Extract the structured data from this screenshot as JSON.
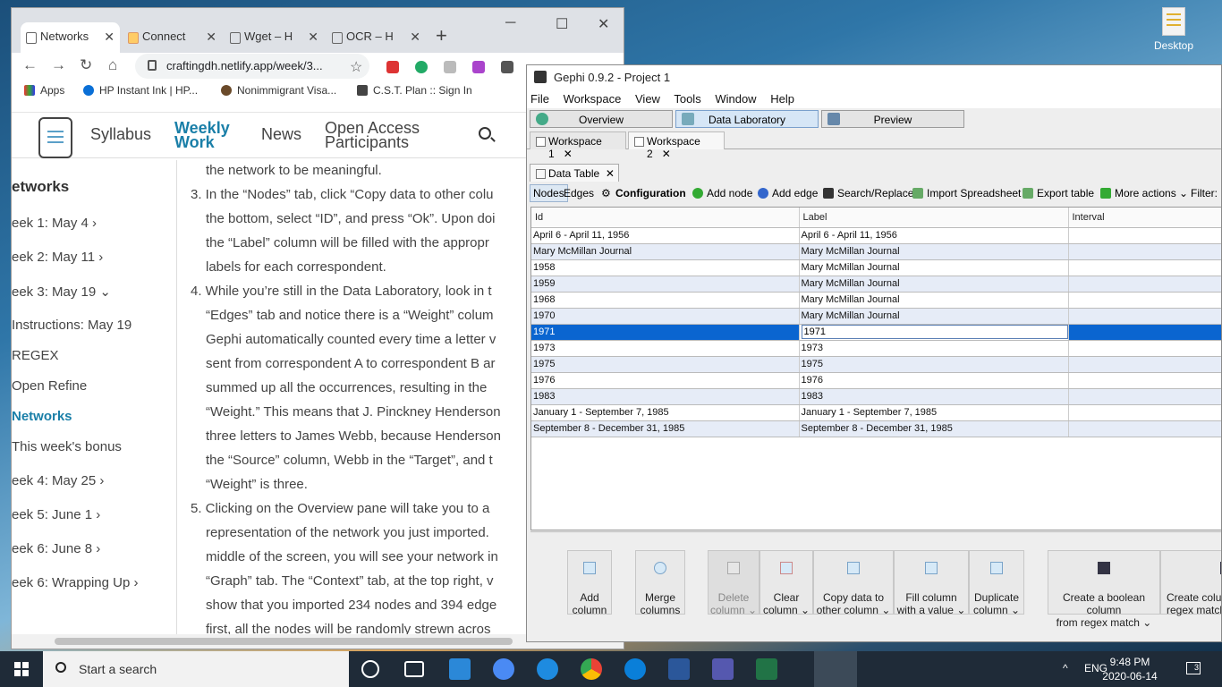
{
  "desktop": {
    "icon_label": "Desktop"
  },
  "chrome": {
    "tabs": [
      "Networks",
      "Connect",
      "Wget – H",
      "OCR – H"
    ],
    "address": "craftingdh.netlify.app/week/3...",
    "bookmarks": [
      "Apps",
      "HP Instant Ink | HP...",
      "Nonimmigrant Visa...",
      "C.S.T. Plan :: Sign In"
    ],
    "site_nav": {
      "syllabus": "Syllabus",
      "weekly_1": "Weekly",
      "weekly_2": "Work",
      "news": "News",
      "open_1": "Open Access",
      "open_2": "Participants"
    },
    "sidebar": {
      "heading": "etworks",
      "items": [
        "eek 1: May 4 ›",
        "eek 2: May 11 ›",
        "eek 3: May 19 ⌄",
        "Instructions: May 19",
        "REGEX",
        "Open Refine",
        "Networks",
        "This week's bonus",
        "eek 4: May 25 ›",
        "eek 5: June 1 ›",
        "eek 6: June 8 ›",
        "eek 6: Wrapping Up ›"
      ]
    },
    "content_lines": [
      "the network to be meaningful.",
      "3. In the “Nodes” tab, click “Copy data to other colu",
      "the bottom, select “ID”, and press “Ok”. Upon doi",
      "the “Label” column will be filled with the appropr",
      "labels for each correspondent.",
      "4. While you’re still in the Data Laboratory, look in t",
      "“Edges” tab and notice there is a “Weight” colum",
      "Gephi automatically counted every time a letter v",
      "sent from correspondent A to correspondent B ar",
      "summed up all the occurrences, resulting in the",
      "“Weight.” This means that J. Pinckney Henderson",
      "three letters to James Webb, because Henderson",
      "the “Source” column, Webb in the “Target”, and t",
      "“Weight” is three.",
      "5. Clicking on the Overview pane will take you to a",
      "representation of the network you just imported.",
      "middle of the screen, you will see your network in",
      "“Graph” tab. The “Context” tab, at the top right, v",
      "show that you imported 234 nodes and 394 edge",
      "first, all the nodes will be randomly strewn acros"
    ]
  },
  "gephi": {
    "title": "Gephi 0.9.2 - Project 1",
    "menu": [
      "File",
      "Workspace",
      "View",
      "Tools",
      "Window",
      "Help"
    ],
    "mode_tabs": [
      "Overview",
      "Data Laboratory",
      "Preview"
    ],
    "workspaces": [
      "Workspace 1",
      "Workspace 2"
    ],
    "data_table_tab": "Data Table",
    "toolbar": {
      "nodes": "Nodes",
      "edges": "Edges",
      "configuration": "Configuration",
      "add_node": "Add node",
      "add_edge": "Add edge",
      "search_replace": "Search/Replace",
      "import": "Import Spreadsheet",
      "export": "Export table",
      "more": "More actions",
      "filter": "Filter:"
    },
    "columns": [
      "Id",
      "Label",
      "Interval"
    ],
    "rows": [
      [
        "April 6 - April 11, 1956",
        "April 6 - April 11, 1956",
        ""
      ],
      [
        "Mary McMillan Journal",
        "Mary McMillan Journal",
        ""
      ],
      [
        "1958",
        "Mary McMillan Journal",
        ""
      ],
      [
        "1959",
        "Mary McMillan Journal",
        ""
      ],
      [
        "1968",
        "Mary McMillan Journal",
        ""
      ],
      [
        "1970",
        "Mary McMillan Journal",
        ""
      ],
      [
        "1971",
        "1971",
        ""
      ],
      [
        "1973",
        "1973",
        ""
      ],
      [
        "1975",
        "1975",
        ""
      ],
      [
        "1976",
        "1976",
        ""
      ],
      [
        "1983",
        "1983",
        ""
      ],
      [
        "January 1 - September 7, 1985",
        "January 1 - September 7, 1985",
        ""
      ],
      [
        "September 8 - December 31, 1985",
        "September 8 - December 31, 1985",
        ""
      ]
    ],
    "selected_row": 6,
    "actions": [
      [
        "Add",
        "column"
      ],
      [
        "Merge",
        "columns"
      ],
      [
        "Delete",
        "column ⌄"
      ],
      [
        "Clear",
        "column ⌄"
      ],
      [
        "Copy data to",
        "other column ⌄"
      ],
      [
        "Fill column",
        "with a value ⌄"
      ],
      [
        "Duplicate",
        "column ⌄"
      ],
      [
        "Create a boolean column",
        "from regex match ⌄"
      ],
      [
        "Create colum",
        "regex matchi"
      ]
    ]
  },
  "taskbar": {
    "search_placeholder": "Start a search",
    "lang": "ENG",
    "time": "9:48 PM",
    "date": "2020-06-14",
    "notifications": "3"
  }
}
